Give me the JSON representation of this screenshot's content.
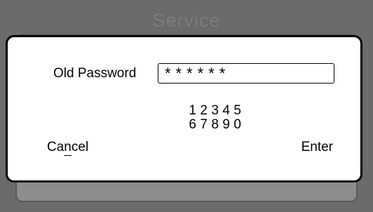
{
  "screen": {
    "background_title": "Service"
  },
  "dialog": {
    "field_label": "Old Password",
    "password_value": "******",
    "keypad": {
      "row1": [
        "1",
        "2",
        "3",
        "4",
        "5"
      ],
      "row2": [
        "6",
        "7",
        "8",
        "9",
        "0"
      ]
    },
    "cancel": {
      "part1": "Ca",
      "underlined_char": "n",
      "part2": "cel"
    },
    "enter_label": "Enter"
  },
  "colors": {
    "screen_background": "#6b6b6b",
    "dialog_background": "#ffffff",
    "dialog_border": "#000000",
    "background_title": "#7e7e7e"
  }
}
